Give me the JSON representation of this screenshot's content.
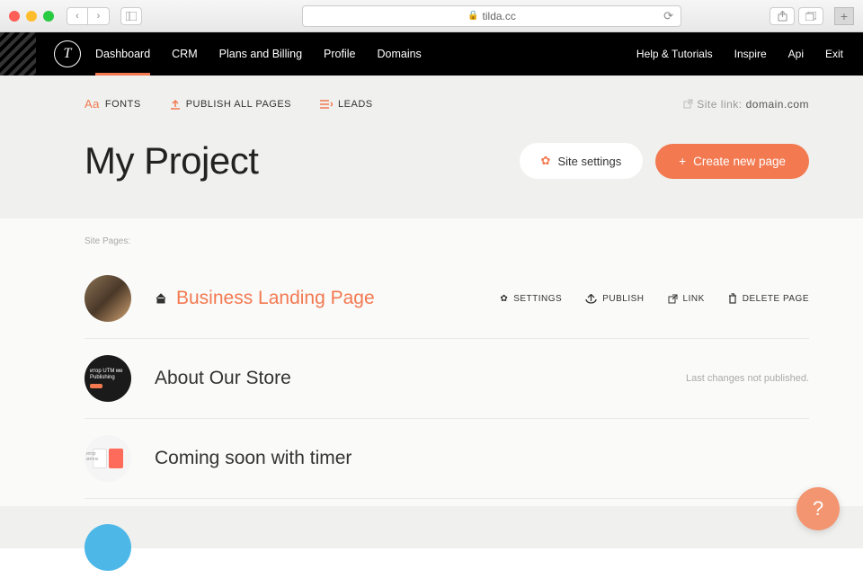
{
  "browser": {
    "url": "tilda.cc"
  },
  "nav": {
    "primary": [
      "Dashboard",
      "CRM",
      "Plans and Billing",
      "Profile",
      "Domains"
    ],
    "secondary": [
      "Help & Tutorials",
      "Inspire",
      "Api",
      "Exit"
    ]
  },
  "toolbar": {
    "fonts": "FONTS",
    "publish_all": "PUBLISH ALL PAGES",
    "leads": "LEADS",
    "site_link_label": "Site link:",
    "site_link_domain": "domain.com"
  },
  "header": {
    "title": "My Project",
    "settings_btn": "Site settings",
    "create_btn": "Create new page"
  },
  "pages": {
    "label": "Site Pages:",
    "actions": {
      "settings": "SETTINGS",
      "publish": "PUBLISH",
      "link": "LINK",
      "delete": "DELETE PAGE"
    },
    "status_unpublished": "Last changes not published.",
    "items": [
      {
        "title": "Business Landing Page",
        "is_home": true,
        "highlighted": true
      },
      {
        "title": "About Our Store",
        "is_home": false,
        "highlighted": false
      },
      {
        "title": "Coming soon with timer",
        "is_home": false,
        "highlighted": false
      }
    ]
  },
  "help_char": "?"
}
